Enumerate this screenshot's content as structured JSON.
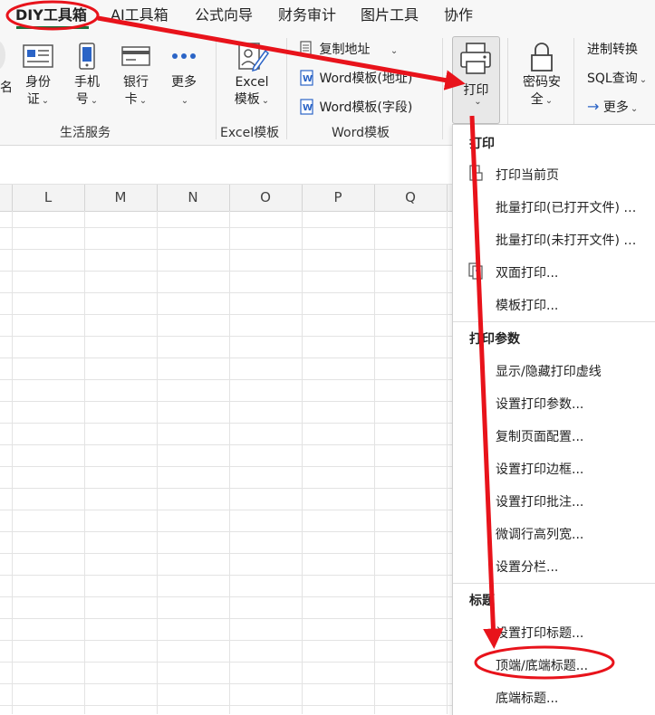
{
  "tabs": [
    "DIY工具箱",
    "AI工具箱",
    "公式向导",
    "财务审计",
    "图片工具",
    "协作"
  ],
  "ribbon": {
    "partial_label": "名",
    "id_card": [
      "身份",
      "证"
    ],
    "phone": [
      "手机",
      "号"
    ],
    "bank_card": [
      "银行",
      "卡"
    ],
    "more": "更多",
    "life_services": "生活服务",
    "excel_template": [
      "Excel",
      "模板"
    ],
    "excel_group": "Excel模板",
    "copy_address": "复制地址",
    "word_template_address": "Word模板(地址)",
    "word_template_field": "Word模板(字段)",
    "word_group": "Word模板",
    "print": "打印",
    "password": [
      "密码安",
      "全"
    ],
    "base_convert": "进制转换",
    "sql_query": "SQL查询",
    "more2": "更多"
  },
  "columns": [
    "L",
    "M",
    "N",
    "O",
    "P",
    "Q"
  ],
  "menu": {
    "print_header": "打印",
    "print_current": "打印当前页",
    "batch_open": "批量打印(已打开文件) …",
    "batch_closed": "批量打印(未打开文件) …",
    "duplex": "双面打印...",
    "template_print": "模板打印...",
    "params_header": "打印参数",
    "toggle_lines": "显示/隐藏打印虚线",
    "set_params": "设置打印参数...",
    "copy_page": "复制页面配置...",
    "set_border": "设置打印边框...",
    "set_comment": "设置打印批注...",
    "fine_tune": "微调行高列宽...",
    "set_columns": "设置分栏...",
    "title_header": "标题",
    "set_title": "设置打印标题...",
    "top_bottom_title": "顶端/底端标题...",
    "bottom_title": "底端标题..."
  },
  "colors": {
    "accent": "#1e6e3a",
    "annotation": "#e8131b",
    "word_blue": "#2b64c6"
  }
}
